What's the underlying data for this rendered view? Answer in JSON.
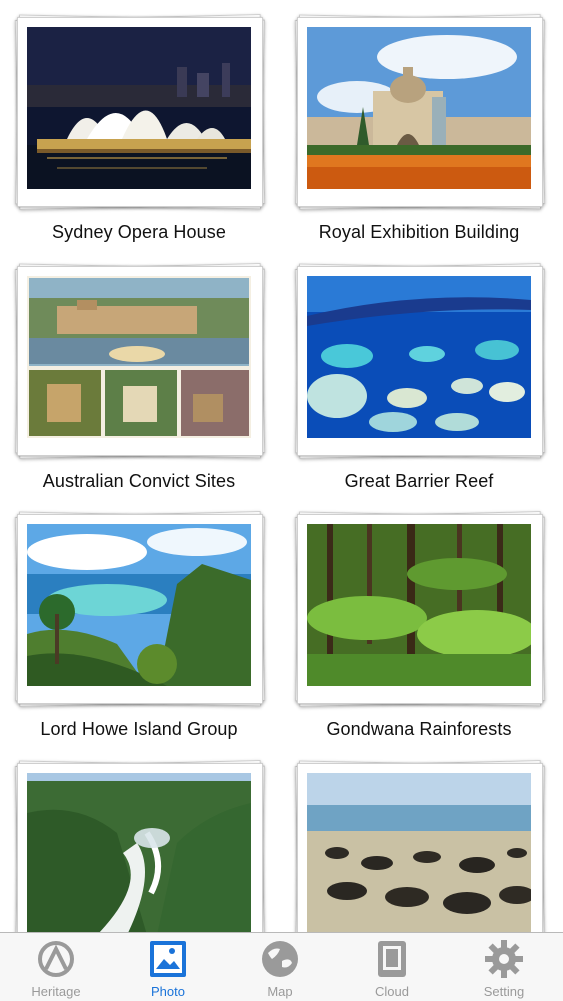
{
  "grid": {
    "items": [
      {
        "caption": "Sydney Opera House",
        "image": "sydney-opera-house-photo"
      },
      {
        "caption": "Royal Exhibition Building",
        "image": "royal-exhibition-building-photo"
      },
      {
        "caption": "Australian Convict Sites",
        "image": "australian-convict-sites-photo"
      },
      {
        "caption": "Great Barrier Reef",
        "image": "great-barrier-reef-photo"
      },
      {
        "caption": "Lord Howe Island Group",
        "image": "lord-howe-island-photo"
      },
      {
        "caption": "Gondwana Rainforests",
        "image": "gondwana-rainforests-photo"
      },
      {
        "caption": "",
        "image": "waterfall-rainforest-photo"
      },
      {
        "caption": "",
        "image": "stromatolites-shoreline-photo"
      }
    ]
  },
  "tabbar": {
    "tabs": [
      {
        "label": "Heritage",
        "icon": "heritage-icon",
        "active": false
      },
      {
        "label": "Photo",
        "icon": "photo-icon",
        "active": true
      },
      {
        "label": "Map",
        "icon": "globe-icon",
        "active": false
      },
      {
        "label": "Cloud",
        "icon": "cloud-icon",
        "active": false
      },
      {
        "label": "Setting",
        "icon": "gear-icon",
        "active": false
      }
    ],
    "active_color": "#1a73d9",
    "inactive_color": "#9a9a9a"
  }
}
